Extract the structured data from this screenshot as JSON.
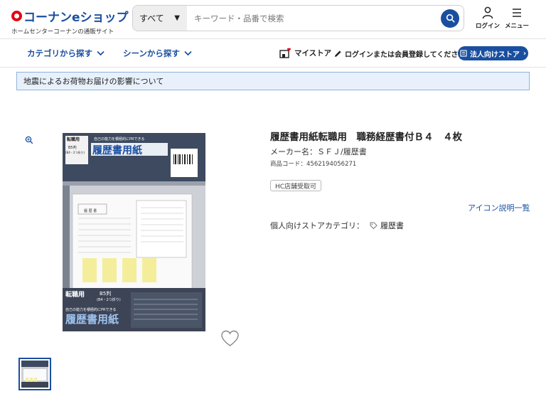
{
  "header": {
    "logo_text": "コーナンeショップ",
    "logo_subtitle": "ホームセンターコーナンの通販サイト",
    "search_category": "すべて",
    "search_placeholder": "キーワード・品番で検索",
    "login_label": "ログイン",
    "menu_label": "メニュー"
  },
  "nav": {
    "category_label": "カテゴリから探す",
    "scene_label": "シーンから探す",
    "mystore_label": "マイストア",
    "login_register_label": "ログインまたは会員登録してください",
    "business_store_label": "法人向けストア"
  },
  "notice": {
    "text": "地震によるお荷物お届けの影響について"
  },
  "product": {
    "title": "履歴書用紙転職用　職務経歴書付Ｂ４　４枚",
    "maker": "メーカー名：ＳＦＪ/履歴書",
    "code": "商品コード：4562194056271",
    "badge": "HC店舗受取可",
    "icon_list_link": "アイコン説明一覧",
    "store_category_label": "個人向けストアカテゴリ：",
    "store_category_value": "履歴書",
    "package": {
      "top_kind": "転職用",
      "top_size": "B5判",
      "top_size_sub": "(B4・2つ折り)",
      "tagline": "自己の能力を積極的にPRできる",
      "name": "履歴書用紙",
      "bottom_kind": "転職用",
      "bottom_size": "B5判",
      "bottom_size_sub": "(B4・2つ折り)",
      "bottom_tagline": "自己の能力を積極的にPRできる",
      "bottom_name": "履歴書用紙",
      "sheet_title": "履 歴 書"
    }
  },
  "colors": {
    "brand_blue": "#1a4fa0",
    "brand_red": "#e60012",
    "notice_bg": "#e8f1fb",
    "notice_border": "#8fb2dd"
  }
}
